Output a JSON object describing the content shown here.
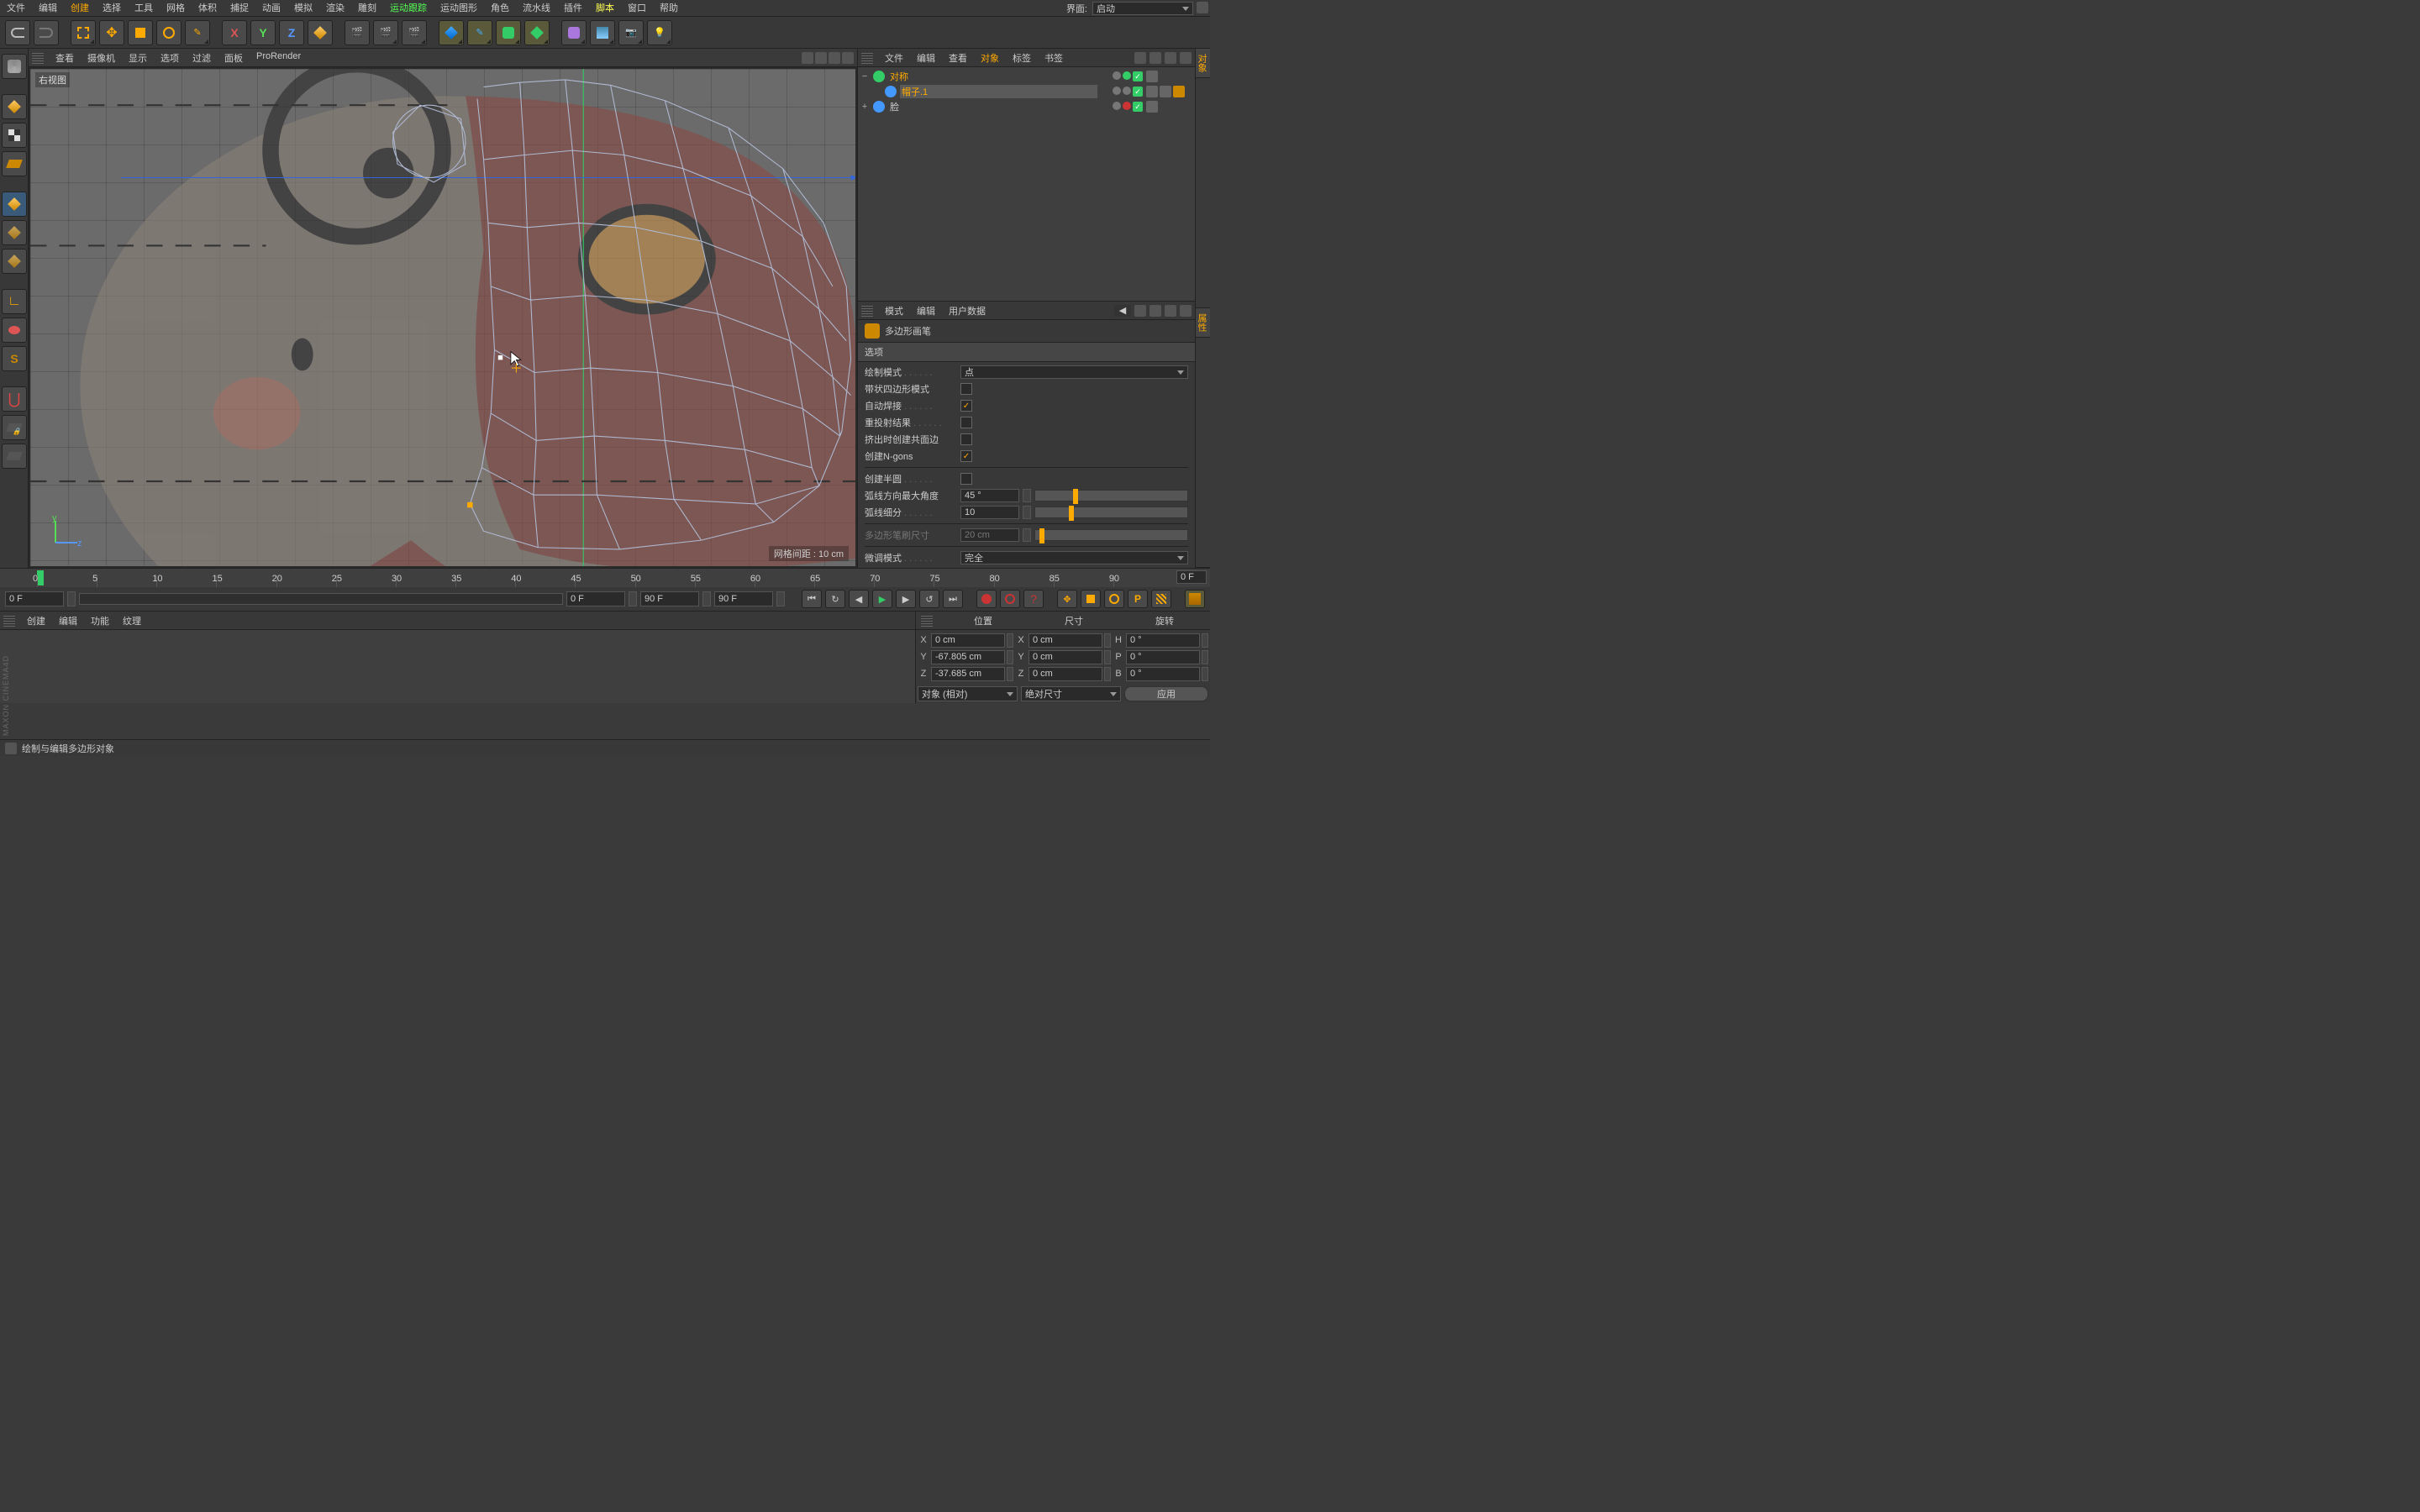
{
  "menu": [
    "文件",
    "编辑",
    "创建",
    "选择",
    "工具",
    "网格",
    "体积",
    "捕捉",
    "动画",
    "模拟",
    "渲染",
    "雕刻",
    "运动跟踪",
    "运动图形",
    "角色",
    "流水线",
    "插件",
    "脚本",
    "窗口",
    "帮助"
  ],
  "menu_hl": {
    "创建": "orange",
    "运动跟踪": "green",
    "脚本": "yellow"
  },
  "interface": {
    "label": "界面:",
    "value": "启动"
  },
  "viewport_menu": [
    "查看",
    "摄像机",
    "显示",
    "选项",
    "过滤",
    "面板",
    "ProRender"
  ],
  "viewport": {
    "label": "右视图",
    "grid_info": "网格间距 : 10 cm"
  },
  "obj_header": [
    "文件",
    "编辑",
    "查看",
    "对象",
    "标签",
    "书签"
  ],
  "obj_header_hl": "对象",
  "tree": [
    {
      "indent": 0,
      "toggle": "−",
      "icon": "#3c6",
      "name": "对称",
      "sel": false,
      "orange": true,
      "dots": [
        "#777",
        "#3c6"
      ],
      "tags": 1
    },
    {
      "indent": 1,
      "toggle": "",
      "icon": "#49f",
      "name": "帽子.1",
      "sel": true,
      "orange": true,
      "dots": [
        "#777",
        "#777"
      ],
      "tags": 2
    },
    {
      "indent": 0,
      "toggle": "+",
      "icon": "#49f",
      "name": "脸",
      "sel": false,
      "orange": false,
      "dots": [
        "#777",
        "#c33"
      ],
      "tags": 1
    }
  ],
  "attr_header": [
    "模式",
    "编辑",
    "用户数据"
  ],
  "attr_title": "多边形画笔",
  "attr_section": "选项",
  "attr": {
    "draw_mode": {
      "label": "绘制模式",
      "value": "点"
    },
    "strip_mode": {
      "label": "带状四边形模式",
      "checked": false
    },
    "auto_weld": {
      "label": "自动焊接",
      "checked": true
    },
    "reproject": {
      "label": "重投射结果",
      "checked": false
    },
    "extrude_shared": {
      "label": "挤出时创建共面边",
      "checked": false
    },
    "ngons": {
      "label": "创建N-gons",
      "checked": true
    },
    "half_circle": {
      "label": "创建半圆",
      "checked": false
    },
    "arc_max_angle": {
      "label": "弧线方向最大角度",
      "value": "45 °",
      "slider": 25
    },
    "arc_subdiv": {
      "label": "弧线细分",
      "value": "10",
      "slider": 22
    },
    "brush_size": {
      "label": "多边形笔刷尺寸",
      "value": "20 cm",
      "dim": true,
      "slider": 3
    },
    "tweak_mode": {
      "label": "微调模式",
      "value": "完全"
    }
  },
  "timeline": {
    "ticks": [
      "0",
      "5",
      "10",
      "15",
      "20",
      "25",
      "30",
      "35",
      "40",
      "45",
      "50",
      "55",
      "60",
      "65",
      "70",
      "75",
      "80",
      "85",
      "90"
    ],
    "end_field": "0 F",
    "start": "0 F",
    "range_start": "0 F",
    "range_end": "90 F",
    "end": "90 F"
  },
  "mat_header": [
    "创建",
    "编辑",
    "功能",
    "纹理"
  ],
  "coord": {
    "headers": [
      "位置",
      "尺寸",
      "旋转"
    ],
    "rows": [
      {
        "a1": "X",
        "v1": "0 cm",
        "a2": "X",
        "v2": "0 cm",
        "a3": "H",
        "v3": "0 °"
      },
      {
        "a1": "Y",
        "v1": "-67.805 cm",
        "a2": "Y",
        "v2": "0 cm",
        "a3": "P",
        "v3": "0 °"
      },
      {
        "a1": "Z",
        "v1": "-37.685 cm",
        "a2": "Z",
        "v2": "0 cm",
        "a3": "B",
        "v3": "0 °"
      }
    ],
    "mode": "对象 (相对)",
    "abs": "绝对尺寸",
    "apply": "应用"
  },
  "status": "绘制与编辑多边形对象",
  "right_tabs": [
    "对象",
    "属性"
  ],
  "brand": "MAXON CINEMA4D"
}
